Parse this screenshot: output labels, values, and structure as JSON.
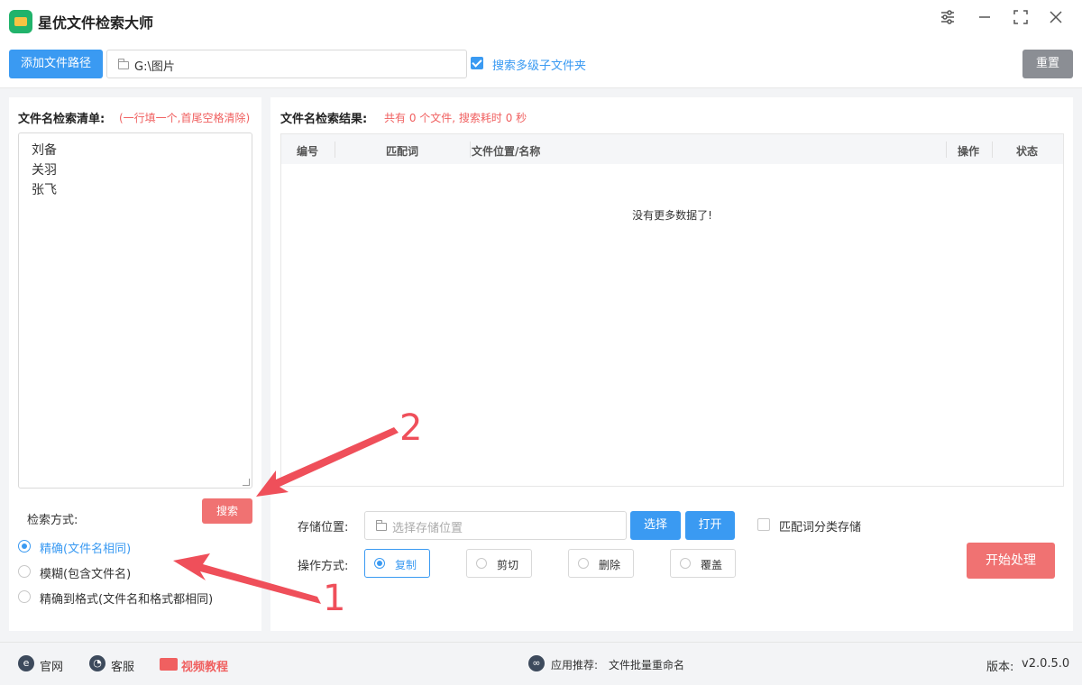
{
  "app": {
    "title": "星优文件检索大师"
  },
  "toolbar": {
    "add_path_label": "添加文件路径",
    "path_value": "G:\\图片",
    "search_subfolders_label": "搜索多级子文件夹",
    "search_subfolders_checked": true,
    "reset_label": "重置"
  },
  "left_panel": {
    "list_label": "文件名检索清单:",
    "list_hint": "(一行填一个,首尾空格清除)",
    "list_items": [
      "刘备",
      "关羽",
      "张飞"
    ],
    "mode_label": "检索方式:",
    "search_button": "搜索",
    "modes": [
      {
        "label": "精确(文件名相同)",
        "selected": true
      },
      {
        "label": "模糊(包含文件名)",
        "selected": false
      },
      {
        "label": "精确到格式(文件名和格式都相同)",
        "selected": false
      }
    ]
  },
  "results": {
    "label": "文件名检索结果:",
    "summary": "共有 0 个文件, 搜索耗时 0 秒",
    "columns": [
      "编号",
      "匹配词",
      "文件位置/名称",
      "操作",
      "状态"
    ],
    "empty_text": "没有更多数据了!"
  },
  "storage": {
    "label": "存储位置:",
    "placeholder": "选择存储位置",
    "select_button": "选择",
    "open_button": "打开",
    "classify_label": "匹配词分类存储",
    "classify_checked": false
  },
  "operation": {
    "label": "操作方式:",
    "options": [
      {
        "label": "复制",
        "selected": true
      },
      {
        "label": "剪切",
        "selected": false
      },
      {
        "label": "删除",
        "selected": false
      },
      {
        "label": "覆盖",
        "selected": false
      }
    ],
    "start_button": "开始处理"
  },
  "footer": {
    "website": "官网",
    "support": "客服",
    "video": "视频教程",
    "recommend_label": "应用推荐:",
    "recommend_app": "文件批量重命名",
    "version_label": "版本:",
    "version": "v2.0.5.0"
  },
  "annotations": {
    "one": "1",
    "two": "2"
  },
  "colors": {
    "accent": "#3a9af2",
    "danger": "#f07272",
    "annotation": "#ef4f5a"
  }
}
